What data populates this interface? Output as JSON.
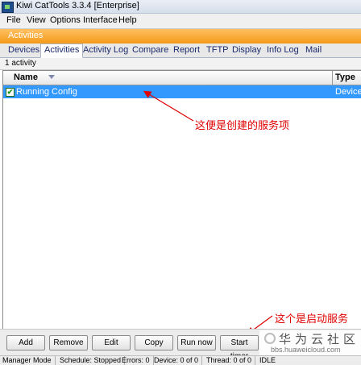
{
  "window": {
    "title": "Kiwi CatTools 3.3.4 [Enterprise]",
    "icon": "app-icon"
  },
  "menu": [
    "File",
    "View",
    "Options",
    "Interface",
    "Help"
  ],
  "banner": "Activities",
  "tabs": [
    "Devices",
    "Activities",
    "Activity Log",
    "Compare",
    "Report",
    "TFTP",
    "Display",
    "Info Log",
    "Mail"
  ],
  "active_tab": "Activities",
  "activity_count": "1 activity",
  "grid": {
    "columns": [
      "Name",
      "Type"
    ],
    "rows": [
      {
        "checked": true,
        "name": "Running Config",
        "type": "Device.B"
      }
    ]
  },
  "annotations": {
    "created_item": "这便是创建的服务项",
    "start_service": "这个是启动服务"
  },
  "buttons": [
    "Add",
    "Remove",
    "Edit",
    "Copy",
    "Run now",
    "Start timer"
  ],
  "status": {
    "mode": "Manager Mode",
    "schedule": "Schedule: Stopped",
    "errors": "Errors: 0",
    "device": "Device: 0 of 0",
    "thread": "Thread: 0 of 0",
    "state": "IDLE"
  },
  "watermark": {
    "title": "华为云社区",
    "url": "bbs.huaweicloud.com"
  },
  "colors": {
    "selection": "#3399ff",
    "banner": "#f49a1a",
    "annotation": "#e00000"
  }
}
